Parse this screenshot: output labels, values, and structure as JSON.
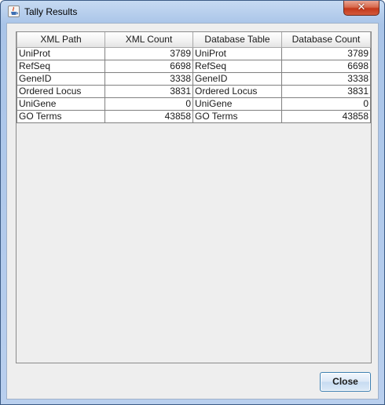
{
  "window": {
    "title": "Tally Results",
    "title_icon": "java-cup-icon",
    "close_glyph": "✕"
  },
  "table": {
    "columns": [
      "XML Path",
      "XML Count",
      "Database Table",
      "Database Count"
    ],
    "rows": [
      [
        "UniProt",
        "3789",
        "UniProt",
        "3789"
      ],
      [
        "RefSeq",
        "6698",
        "RefSeq",
        "6698"
      ],
      [
        "GeneID",
        "3338",
        "GeneID",
        "3338"
      ],
      [
        "Ordered Locus",
        "3831",
        "Ordered Locus",
        "3831"
      ],
      [
        "UniGene",
        "0",
        "UniGene",
        "0"
      ],
      [
        "GO Terms",
        "43858",
        "GO Terms",
        "43858"
      ]
    ]
  },
  "buttons": {
    "close_label": "Close"
  }
}
